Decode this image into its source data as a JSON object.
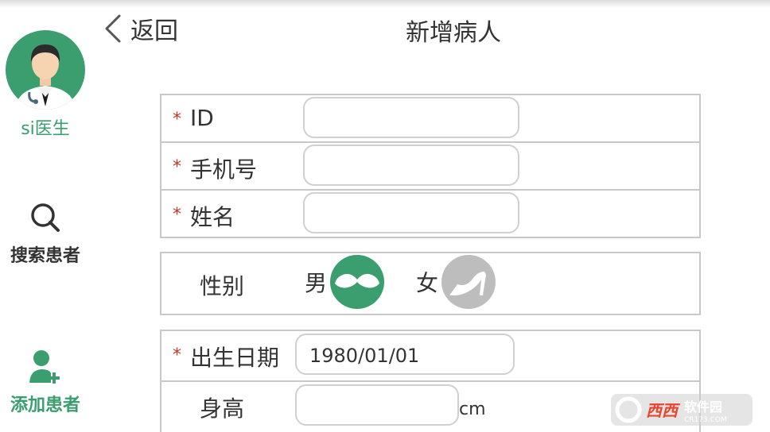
{
  "header": {
    "back_label": "返回",
    "title": "新增病人"
  },
  "sidebar": {
    "doctor_name": "si医生",
    "search_label": "搜索患者",
    "add_label": "添加患者",
    "accent_color": "#3a9e6e"
  },
  "form": {
    "required_mark": "*",
    "id_label": "ID",
    "id_value": "",
    "phone_label": "手机号",
    "phone_value": "",
    "name_label": "姓名",
    "name_value": "",
    "gender_label": "性别",
    "gender_male": "男",
    "gender_female": "女",
    "gender_selected": "男",
    "birth_label": "出生日期",
    "birth_value": "1980/01/01",
    "height_label": "身高",
    "height_value": "",
    "height_unit": "cm"
  },
  "watermark": {
    "brand": "西西软件园",
    "site": "CR173.COM"
  }
}
